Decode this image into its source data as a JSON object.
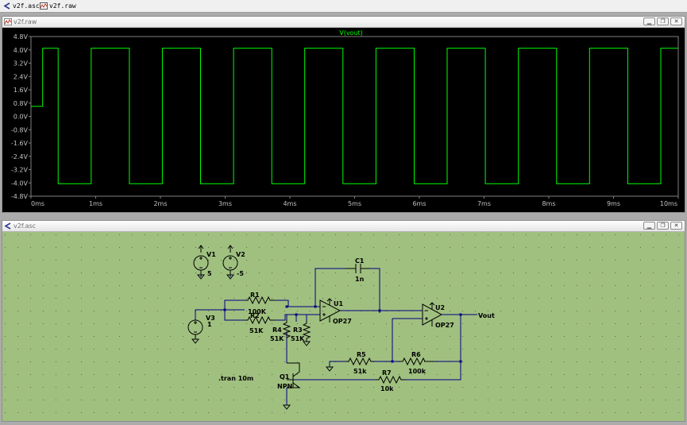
{
  "tabs": [
    {
      "label": "v2f.asc",
      "icon": "schematic-icon"
    },
    {
      "label": "v2f.raw",
      "icon": "waveform-icon"
    }
  ],
  "plot_window": {
    "title": "v2f.raw",
    "trace_name": "V(vout)"
  },
  "schematic_window": {
    "title": "v2f.asc"
  },
  "window_buttons": {
    "minimize": "▁",
    "restore": "❐",
    "close": "✕"
  },
  "chart_data": {
    "type": "line",
    "series": [
      {
        "name": "V(vout)",
        "color": "#00ff00"
      }
    ],
    "y_ticks": [
      "4.8V",
      "4.0V",
      "3.2V",
      "2.4V",
      "1.6V",
      "0.8V",
      "0.0V",
      "-0.8V",
      "-1.6V",
      "-2.4V",
      "-3.2V",
      "-4.0V",
      "-4.8V"
    ],
    "x_ticks": [
      "0ms",
      "1ms",
      "2ms",
      "3ms",
      "4ms",
      "5ms",
      "6ms",
      "7ms",
      "8ms",
      "9ms",
      "10ms"
    ],
    "ylim": [
      -4.8,
      4.8
    ],
    "xlim": [
      0,
      10
    ],
    "start_value": 0.6,
    "high_value": 4.1,
    "low_value": -4.05,
    "segments": [
      {
        "t0": 0.0,
        "t1": 0.18,
        "v": 0.6
      },
      {
        "t0": 0.18,
        "t1": 0.42,
        "v": 4.1
      },
      {
        "t0": 0.42,
        "t1": 0.93,
        "v": -4.05
      },
      {
        "t0": 0.93,
        "t1": 1.52,
        "v": 4.1
      },
      {
        "t0": 1.52,
        "t1": 2.03,
        "v": -4.05
      },
      {
        "t0": 2.03,
        "t1": 2.62,
        "v": 4.1
      },
      {
        "t0": 2.62,
        "t1": 3.13,
        "v": -4.05
      },
      {
        "t0": 3.13,
        "t1": 3.72,
        "v": 4.1
      },
      {
        "t0": 3.72,
        "t1": 4.23,
        "v": -4.05
      },
      {
        "t0": 4.23,
        "t1": 4.82,
        "v": 4.1
      },
      {
        "t0": 4.82,
        "t1": 5.33,
        "v": -4.05
      },
      {
        "t0": 5.33,
        "t1": 5.92,
        "v": 4.1
      },
      {
        "t0": 5.92,
        "t1": 6.43,
        "v": -4.05
      },
      {
        "t0": 6.43,
        "t1": 7.02,
        "v": 4.1
      },
      {
        "t0": 7.02,
        "t1": 7.53,
        "v": -4.05
      },
      {
        "t0": 7.53,
        "t1": 8.12,
        "v": 4.1
      },
      {
        "t0": 8.12,
        "t1": 8.63,
        "v": -4.05
      },
      {
        "t0": 8.63,
        "t1": 9.22,
        "v": 4.1
      },
      {
        "t0": 9.22,
        "t1": 9.73,
        "v": -4.05
      },
      {
        "t0": 9.73,
        "t1": 10.0,
        "v": 4.1
      }
    ]
  },
  "schematic": {
    "sim_directive": ".tran 10m",
    "output_label": "Vout",
    "components": {
      "V1": {
        "name": "V1",
        "value": "5"
      },
      "V2": {
        "name": "V2",
        "value": "-5"
      },
      "V3": {
        "name": "V3",
        "value": "1"
      },
      "R1": {
        "name": "R1",
        "value": "100K"
      },
      "R2": {
        "name": "R2",
        "value": "51K"
      },
      "R3": {
        "name": "R3",
        "value": "51K"
      },
      "R4": {
        "name": "R4",
        "value": "51K"
      },
      "R5": {
        "name": "R5",
        "value": "51k"
      },
      "R6": {
        "name": "R6",
        "value": "100k"
      },
      "R7": {
        "name": "R7",
        "value": "10k"
      },
      "C1": {
        "name": "C1",
        "value": "1n"
      },
      "U1": {
        "name": "U1",
        "value": "OP27"
      },
      "U2": {
        "name": "U2",
        "value": "OP27"
      },
      "Q1": {
        "name": "Q1",
        "value": "NPN"
      }
    }
  },
  "colors": {
    "trace": "#00ff00",
    "plot_bg": "#000000",
    "schematic_bg": "#a0c080",
    "wire": "#000080",
    "component": "#000000"
  }
}
